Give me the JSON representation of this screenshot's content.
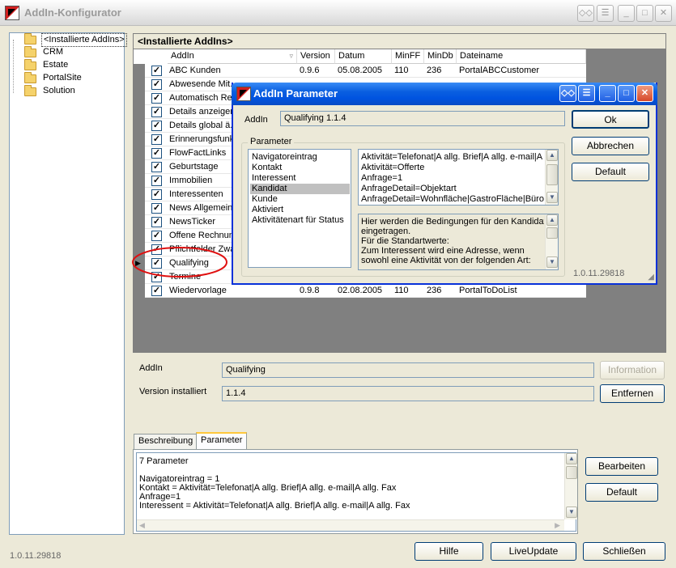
{
  "window": {
    "title": "AddIn-Konfigurator",
    "title_icon": "addin-app-icon",
    "controls": [
      "◇◇",
      "☰",
      "_",
      "□",
      "✕"
    ]
  },
  "tree": {
    "items": [
      {
        "label": "<Installierte AddIns>",
        "selected": true
      },
      {
        "label": "CRM"
      },
      {
        "label": "Estate"
      },
      {
        "label": "PortalSite"
      },
      {
        "label": "Solution"
      }
    ]
  },
  "grid": {
    "header_title": "<Installierte AddIns>",
    "columns": [
      "AddIn",
      "Version",
      "Datum",
      "MinFF",
      "MinDb",
      "Dateiname"
    ],
    "rows": [
      {
        "addin": "ABC Kunden",
        "version": "0.9.6",
        "datum": "05.08.2005",
        "minff": "110",
        "mindb": "236",
        "datei": "PortalABCCustomer",
        "checked": "✓"
      },
      {
        "addin": "Abwesende Mit...",
        "version": "",
        "datum": "",
        "minff": "",
        "mindb": "",
        "datei": "",
        "checked": "✓"
      },
      {
        "addin": "Automatisch Re...",
        "version": "",
        "datum": "",
        "minff": "",
        "mindb": "",
        "datei": "",
        "checked": "✓"
      },
      {
        "addin": "Details anzeigen",
        "version": "",
        "datum": "",
        "minff": "",
        "mindb": "",
        "datei": "",
        "checked": "✓"
      },
      {
        "addin": "Details global ä...",
        "version": "",
        "datum": "",
        "minff": "",
        "mindb": "",
        "datei": "",
        "checked": "✓"
      },
      {
        "addin": "Erinnerungsfunk...",
        "version": "",
        "datum": "",
        "minff": "",
        "mindb": "",
        "datei": "",
        "checked": "✓"
      },
      {
        "addin": "FlowFactLinks",
        "version": "",
        "datum": "",
        "minff": "",
        "mindb": "",
        "datei": "",
        "checked": "✓"
      },
      {
        "addin": "Geburtstage",
        "version": "",
        "datum": "",
        "minff": "",
        "mindb": "",
        "datei": "",
        "checked": "✓"
      },
      {
        "addin": "Immobilien",
        "version": "",
        "datum": "",
        "minff": "",
        "mindb": "",
        "datei": "",
        "checked": "✓"
      },
      {
        "addin": "Interessenten",
        "version": "",
        "datum": "",
        "minff": "",
        "mindb": "",
        "datei": "",
        "checked": "✓"
      },
      {
        "addin": "News Allgemein",
        "version": "",
        "datum": "",
        "minff": "",
        "mindb": "",
        "datei": "",
        "checked": "✓"
      },
      {
        "addin": "NewsTicker",
        "version": "",
        "datum": "",
        "minff": "",
        "mindb": "",
        "datei": "",
        "checked": "✓"
      },
      {
        "addin": "Offene Rechnun...",
        "version": "",
        "datum": "",
        "minff": "",
        "mindb": "",
        "datei": "",
        "checked": "✓"
      },
      {
        "addin": "Pflichtfelder Zwa...",
        "version": "",
        "datum": "",
        "minff": "",
        "mindb": "",
        "datei": "",
        "checked": "✓"
      },
      {
        "addin": "Qualifying",
        "version": "",
        "datum": "",
        "minff": "",
        "mindb": "",
        "datei": "",
        "checked": "✓"
      },
      {
        "addin": "Termine",
        "version": "",
        "datum": "",
        "minff": "",
        "mindb": "",
        "datei": "",
        "checked": "✓"
      },
      {
        "addin": "Wiedervorlage",
        "version": "0.9.8",
        "datum": "02.08.2005",
        "minff": "110",
        "mindb": "236",
        "datei": "PortalToDoList",
        "checked": "✓"
      }
    ]
  },
  "details": {
    "addin_label": "AddIn",
    "addin_value": "Qualifying",
    "version_label": "Version installiert",
    "version_value": "1.1.4",
    "info_button": "Information",
    "remove_button": "Entfernen"
  },
  "tabs": [
    {
      "label": "Beschreibung"
    },
    {
      "label": "Parameter",
      "active": true
    }
  ],
  "param_text": {
    "lines": [
      "7 Parameter",
      "",
      "Navigatoreintrag = 1",
      "Kontakt = Aktivität=Telefonat|A allg. Brief|A allg. e-mail|A allg. Fax",
      "Anfrage=1",
      "Interessent = Aktivität=Telefonat|A allg. Brief|A allg. e-mail|A allg. Fax"
    ],
    "edit_button": "Bearbeiten",
    "default_button": "Default"
  },
  "footer": {
    "version": "1.0.11.29818",
    "help_button": "Hilfe",
    "liveupdate_button": "LiveUpdate",
    "close_button": "Schließen"
  },
  "dialog": {
    "title": "AddIn Parameter",
    "controls": [
      "◇◇",
      "☰",
      "_",
      "□",
      "✕"
    ],
    "addin_label": "AddIn",
    "addin_value": "Qualifying 1.1.4",
    "ok_button": "Ok",
    "cancel_button": "Abbrechen",
    "default_button": "Default",
    "group_label": "Parameter",
    "params": [
      "Navigatoreintrag",
      "Kontakt",
      "Interessent",
      "Kandidat",
      "Kunde",
      "Aktiviert",
      "Aktivitätenart für Status"
    ],
    "selected_param": "Kandidat",
    "value_lines": [
      "Aktivität=Telefonat|A allg. Brief|A allg. e-mail|A al",
      "Aktivität=Offerte",
      "Anfrage=1",
      "AnfrageDetail=Objektart",
      "AnfrageDetail=Wohnfläche|GastroFläche|Büro-/"
    ],
    "desc_lines": [
      "Hier werden die Bedingungen für den Kandidat",
      "eingetragen.",
      "Für die Standartwerte:",
      "Zum Interessent wird eine Adresse, wenn",
      "sowohl eine Aktivität von der folgenden Art:"
    ],
    "version": "1.0.11.29818"
  },
  "colors": {
    "dialog_titlebar": "#0a5fe0",
    "highlight_ellipse": "#e01010"
  }
}
